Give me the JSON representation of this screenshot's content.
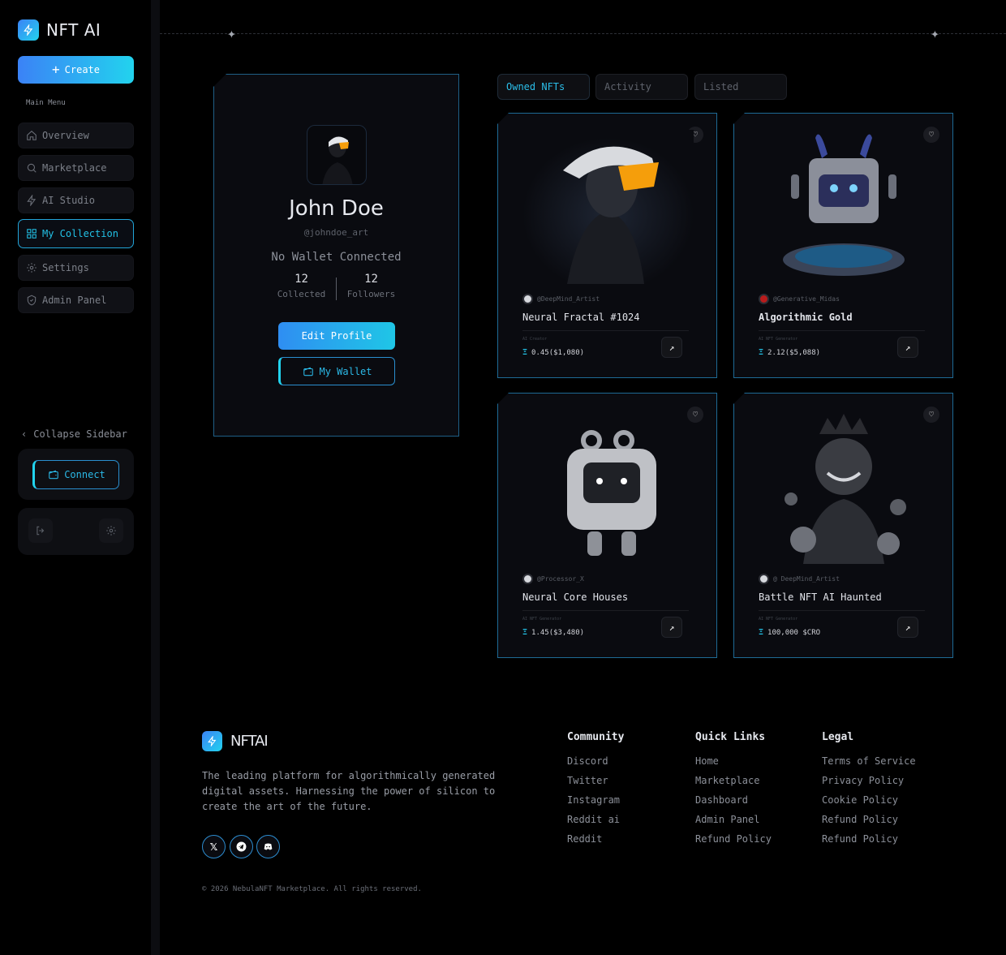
{
  "app": {
    "name": "NFT AI"
  },
  "sidebar": {
    "create_label": "Create",
    "menu_label": "Main Menu",
    "items": [
      {
        "label": "Overview",
        "icon": "home-icon"
      },
      {
        "label": "Marketplace",
        "icon": "search-icon"
      },
      {
        "label": "AI Studio",
        "icon": "bolt-icon"
      },
      {
        "label": "My Collection",
        "icon": "grid-icon",
        "active": true
      },
      {
        "label": "Settings",
        "icon": "gear-icon"
      },
      {
        "label": "Admin Panel",
        "icon": "shield-icon"
      }
    ],
    "collapse_label": "Collapse Sidebar",
    "connect_label": "Connect"
  },
  "profile": {
    "name": "John Doe",
    "handle": "@johndoe_art",
    "wallet_status": "No Wallet Connected",
    "collected_count": "12",
    "collected_label": "Collected",
    "followers_count": "12",
    "followers_label": "Followers",
    "edit_label": "Edit Profile",
    "wallet_label": "My Wallet"
  },
  "tabs": [
    {
      "label": "Owned NFTs",
      "active": true
    },
    {
      "label": "Activity"
    },
    {
      "label": "Listed"
    }
  ],
  "nfts": [
    {
      "creator": "@DeepMind_Artist",
      "title": "Neural Fractal #1024",
      "sub": "AI Creator",
      "price": "0.45($1,080)",
      "art": "helmet-figure"
    },
    {
      "creator": "@Generative_Midas",
      "title": "Algorithmic Gold",
      "sub": "AI NFT Generator",
      "price": "2.12($5,088)",
      "art": "robot-bunny"
    },
    {
      "creator": "@Processor_X",
      "title": "Neural Core Houses",
      "sub": "AI NFT Generator",
      "price": "1.45($3,480)",
      "art": "tv-robot"
    },
    {
      "creator": "@ DeepMind_Artist",
      "title": "Battle NFT AI Haunted",
      "sub": "AI NFT Generator",
      "price": "100,000 $CRO",
      "art": "king-clocks"
    }
  ],
  "footer": {
    "logo_text": "NFTAI",
    "description": "The leading platform for algorithmically generated digital assets. Harnessing the power of silicon to create the art of the future.",
    "socials": [
      "x-icon",
      "telegram-icon",
      "discord-icon"
    ],
    "columns": [
      {
        "heading": "Community",
        "links": [
          "Discord",
          "Twitter",
          "Instagram",
          "Reddit ai",
          "Reddit"
        ]
      },
      {
        "heading": "Quick Links",
        "links": [
          "Home",
          "Marketplace",
          "Dashboard",
          "Admin Panel",
          "Refund Policy"
        ]
      },
      {
        "heading": "Legal",
        "links": [
          "Terms of Service",
          "Privacy Policy",
          "Cookie Policy",
          "Refund Policy",
          "Refund Policy"
        ]
      }
    ],
    "copyright": "© 2026 NebulaNFT Marketplace. All rights reserved."
  },
  "colors": {
    "accent": "#22d3ee",
    "accent_blue": "#3b82f6",
    "background": "#000000",
    "card": "#0a0b10"
  }
}
